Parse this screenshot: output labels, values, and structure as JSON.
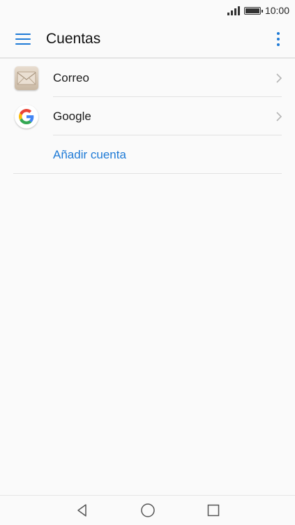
{
  "status_bar": {
    "time": "10:00",
    "icons": [
      "signal-icon",
      "battery-icon"
    ]
  },
  "app_bar": {
    "title": "Cuentas",
    "menu_icon": "hamburger-menu-icon",
    "overflow_icon": "more-vert-icon"
  },
  "accounts": [
    {
      "label": "Correo",
      "icon": "email-app-icon"
    },
    {
      "label": "Google",
      "icon": "google-icon"
    }
  ],
  "add_account_label": "Añadir cuenta",
  "colors": {
    "accent": "#1e7ad6",
    "background": "#fafafa",
    "divider": "#e2e2e2"
  },
  "nav_bar": {
    "icons": [
      "back-icon",
      "home-icon",
      "recents-icon"
    ]
  }
}
